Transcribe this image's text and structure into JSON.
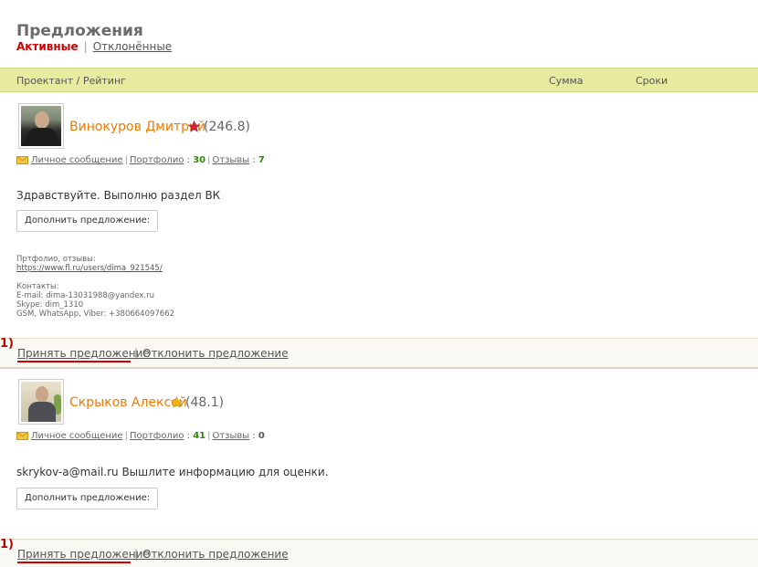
{
  "page": {
    "title": "Предложения",
    "tabs": [
      {
        "label": "Активные",
        "active": true
      },
      {
        "label": "Отклонённые",
        "active": false
      }
    ]
  },
  "table_header": {
    "contractor": "Проектант / Рейтинг",
    "sum": "Сумма",
    "terms": "Сроки"
  },
  "offers": [
    {
      "name": "Винокуров Дмитрий",
      "star_icon": "star-red-icon",
      "rating": "(246.8)",
      "links": {
        "message": "Личное сообщение",
        "portfolio": "Портфолио",
        "portfolio_count": "30",
        "reviews": "Отзывы",
        "reviews_count": "7"
      },
      "text": "Здравствуйте. Выполню раздел ВК",
      "add_button": "Дополнить предложение:",
      "details": {
        "portfolio_label": "Пртфолио, отзывы:",
        "portfolio_url": "https://www.fl.ru/users/dima_921545/",
        "contacts_label": "Контакты:",
        "email": "E-mail: dima-13031988@yandex.ru",
        "skype": "Skype: dim_1310",
        "phone": "GSM, WhatsApp, Viber: +380664097662"
      },
      "actions": {
        "marker": "1)",
        "accept": "Принять предложение",
        "decline": "Отклонить предложение"
      }
    },
    {
      "name": "Скрыков Алексей",
      "star_icon": "star-gold-icon",
      "rating": "(48.1)",
      "links": {
        "message": "Личное сообщение",
        "portfolio": "Портфолио",
        "portfolio_count": "41",
        "reviews": "Отзывы",
        "reviews_count": "0"
      },
      "text": "skrykov-a@mail.ru Вышлите информацию для оценки.",
      "add_button": "Дополнить предложение:",
      "actions": {
        "marker": "1)",
        "accept": "Принять предложение",
        "decline": "Отклонить предложение"
      }
    }
  ],
  "colors": {
    "accent_orange": "#f07a00",
    "active_tab_red": "#cc0000",
    "header_bg": "#e6eba0",
    "count_green": "#2a8a00",
    "marker_red": "#c00000"
  }
}
